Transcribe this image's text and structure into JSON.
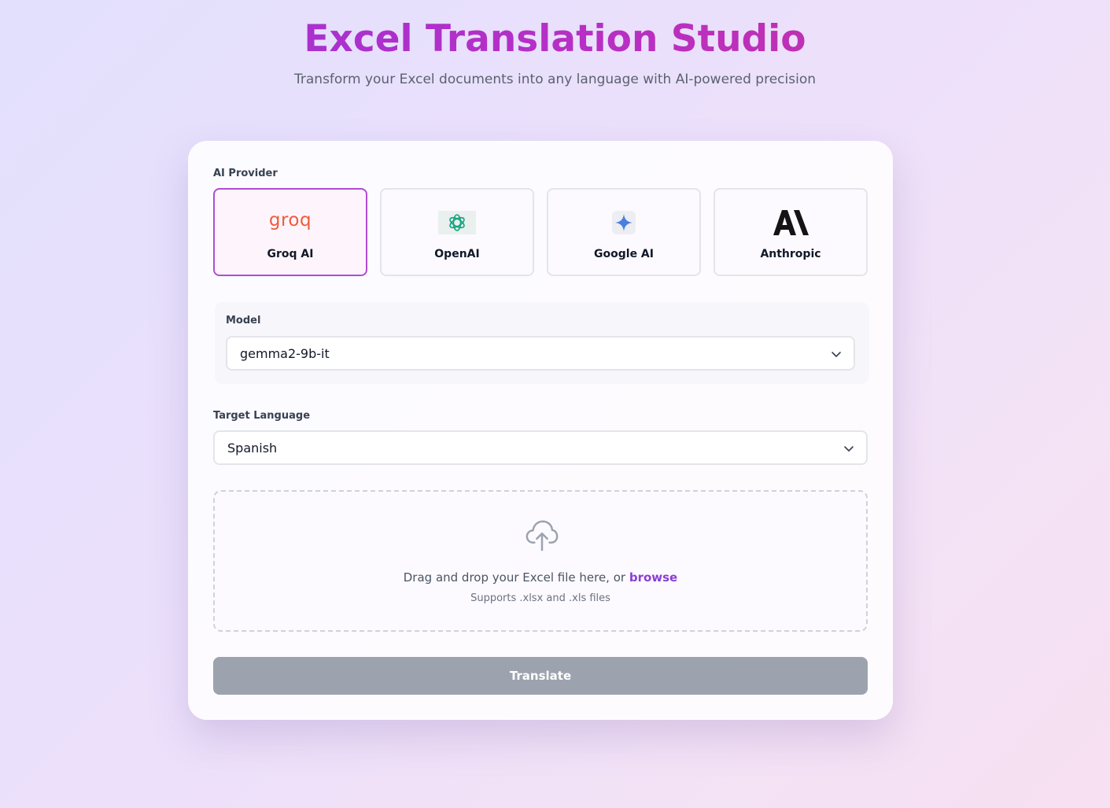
{
  "header": {
    "title": "Excel Translation Studio",
    "subtitle": "Transform your Excel documents into any language with AI-powered precision"
  },
  "provider_section": {
    "label": "AI Provider",
    "providers": [
      {
        "name": "Groq AI",
        "icon": "groq-logo-icon",
        "logo_text": "groq",
        "selected": true
      },
      {
        "name": "OpenAI",
        "icon": "openai-logo-icon",
        "selected": false
      },
      {
        "name": "Google AI",
        "icon": "google-ai-sparkle-icon",
        "selected": false
      },
      {
        "name": "Anthropic",
        "icon": "anthropic-logo-icon",
        "logo_text": "A\\",
        "selected": false
      }
    ]
  },
  "model_section": {
    "label": "Model",
    "selected": "gemma2-9b-it"
  },
  "language_section": {
    "label": "Target Language",
    "selected": "Spanish"
  },
  "upload": {
    "text": "Drag and drop your Excel file here, or ",
    "browse_label": "browse",
    "hint": "Supports .xlsx and .xls files"
  },
  "actions": {
    "translate_label": "Translate"
  },
  "colors": {
    "title_gradient_start": "#9b33d9",
    "title_gradient_end": "#c8329a",
    "selected_border": "#b24bd6",
    "link": "#8b3fd4",
    "button_disabled": "#9ca3af",
    "groq_logo": "#f05a3c",
    "openai_logo": "#10a37f",
    "google_sparkle": "#4a7fe0"
  }
}
